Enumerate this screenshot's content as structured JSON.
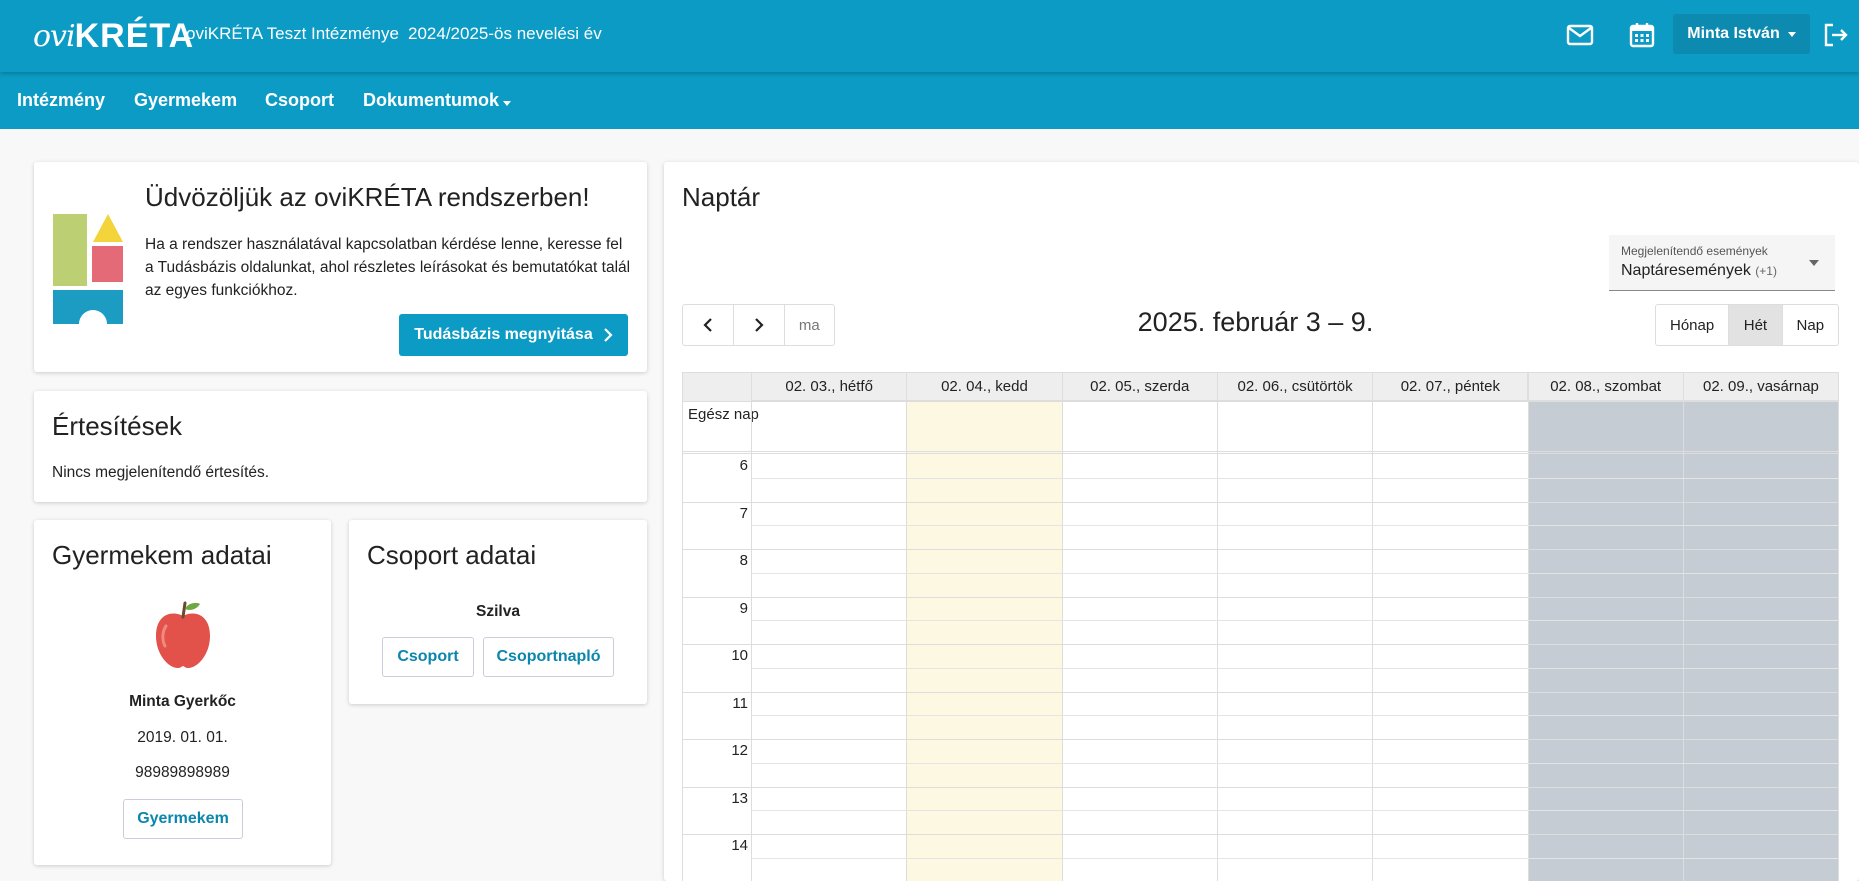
{
  "topbar": {
    "logo_ovi": "ovi",
    "logo_kreta": "KRÉTA",
    "institution": "oviKRÉTA Teszt Intézménye",
    "year": "2024/2025-ös nevelési év",
    "user_name": "Minta István",
    "icons": [
      "mail-icon",
      "calendar-icon",
      "logout-icon"
    ]
  },
  "nav": {
    "items": [
      "Intézmény",
      "Gyermekem",
      "Csoport",
      "Dokumentumok"
    ]
  },
  "welcome": {
    "title": "Üdvözöljük az oviKRÉTA rendszerben!",
    "text": "Ha a rendszer használatával kapcsolatban kérdése lenne, keresse fel a Tudásbázis oldalunkat, ahol részletes leírásokat és bemutatókat talál az egyes funkciókhoz.",
    "button": "Tudásbázis megnyitása"
  },
  "notifications": {
    "title": "Értesítések",
    "empty": "Nincs megjelenítendő értesítés."
  },
  "child": {
    "title": "Gyermekem adatai",
    "name": "Minta Gyerkőc",
    "birth": "2019. 01. 01.",
    "id": "98989898989",
    "button": "Gyermekem"
  },
  "group": {
    "title": "Csoport adatai",
    "name": "Szilva",
    "btn_group": "Csoport",
    "btn_diary": "Csoportnapló"
  },
  "calendar": {
    "title": "Naptár",
    "select_label": "Megjelenítendő események",
    "select_value": "Naptáresemények",
    "select_extra": "(+1)",
    "today": "ma",
    "range": "2025. február 3 – 9.",
    "views": [
      "Hónap",
      "Hét",
      "Nap"
    ],
    "active_view": "Hét",
    "allday": "Egész nap",
    "days": [
      "02. 03., hétfő",
      "02. 04., kedd",
      "02. 05., szerda",
      "02. 06., csütörtök",
      "02. 07., péntek",
      "02. 08., szombat",
      "02. 09., vasárnap"
    ],
    "hours": [
      "6",
      "7",
      "8",
      "9",
      "10",
      "11",
      "12",
      "13",
      "14"
    ],
    "today_color": "#fdf8e2",
    "weekend_color": "#c5ccd3"
  },
  "colors": {
    "brand": "#0b9bc5"
  }
}
